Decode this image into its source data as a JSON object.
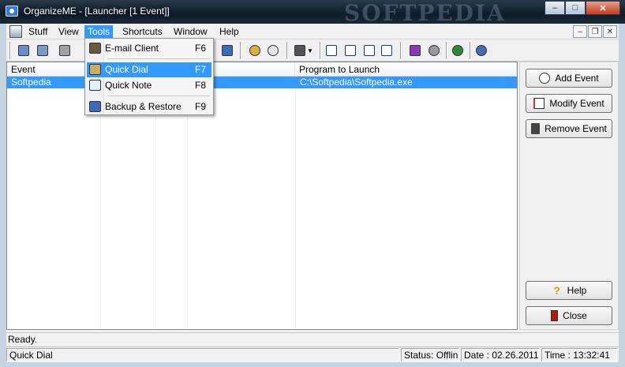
{
  "window": {
    "title": "OrganizeME - [Launcher [1 Event]]",
    "watermark": "SOFTPEDIA",
    "minimize": "–",
    "maximize": "□",
    "close": "✕"
  },
  "menubar": {
    "items": [
      {
        "label": "Stuff"
      },
      {
        "label": "View"
      },
      {
        "label": "Tools"
      },
      {
        "label": "Shortcuts"
      },
      {
        "label": "Window"
      },
      {
        "label": "Help"
      }
    ],
    "mdi_minimize": "–",
    "mdi_restore": "❐",
    "mdi_close": "✕"
  },
  "tools_menu": {
    "items": [
      {
        "label": "E-mail Client",
        "shortcut": "F6",
        "icon": "email-client-icon"
      },
      {
        "label": "Quick Dial",
        "shortcut": "F7",
        "icon": "phone-icon"
      },
      {
        "label": "Quick Note",
        "shortcut": "F8",
        "icon": "note-icon"
      },
      {
        "label": "Backup & Restore",
        "shortcut": "F9",
        "icon": "floppy-disk-icon"
      }
    ]
  },
  "listview": {
    "columns": [
      "Event",
      "",
      "",
      "",
      "Program to Launch"
    ],
    "rows": [
      {
        "event": "Softpedia",
        "program": "C:\\Softpedia\\Softpedia.exe"
      }
    ]
  },
  "actions": {
    "add_event": "Add Event",
    "modify_event": "Modify Event",
    "remove_event": "Remove Event",
    "help": "Help",
    "close": "Close"
  },
  "status": {
    "message": "Ready.",
    "left_pane": "Quick Dial",
    "connection": "Status: Offline",
    "date": "Date : 02.26.2011",
    "time": "Time : 13:32:41"
  },
  "colors": {
    "selection": "#3399ff",
    "titlebar": "#0f1c28"
  }
}
